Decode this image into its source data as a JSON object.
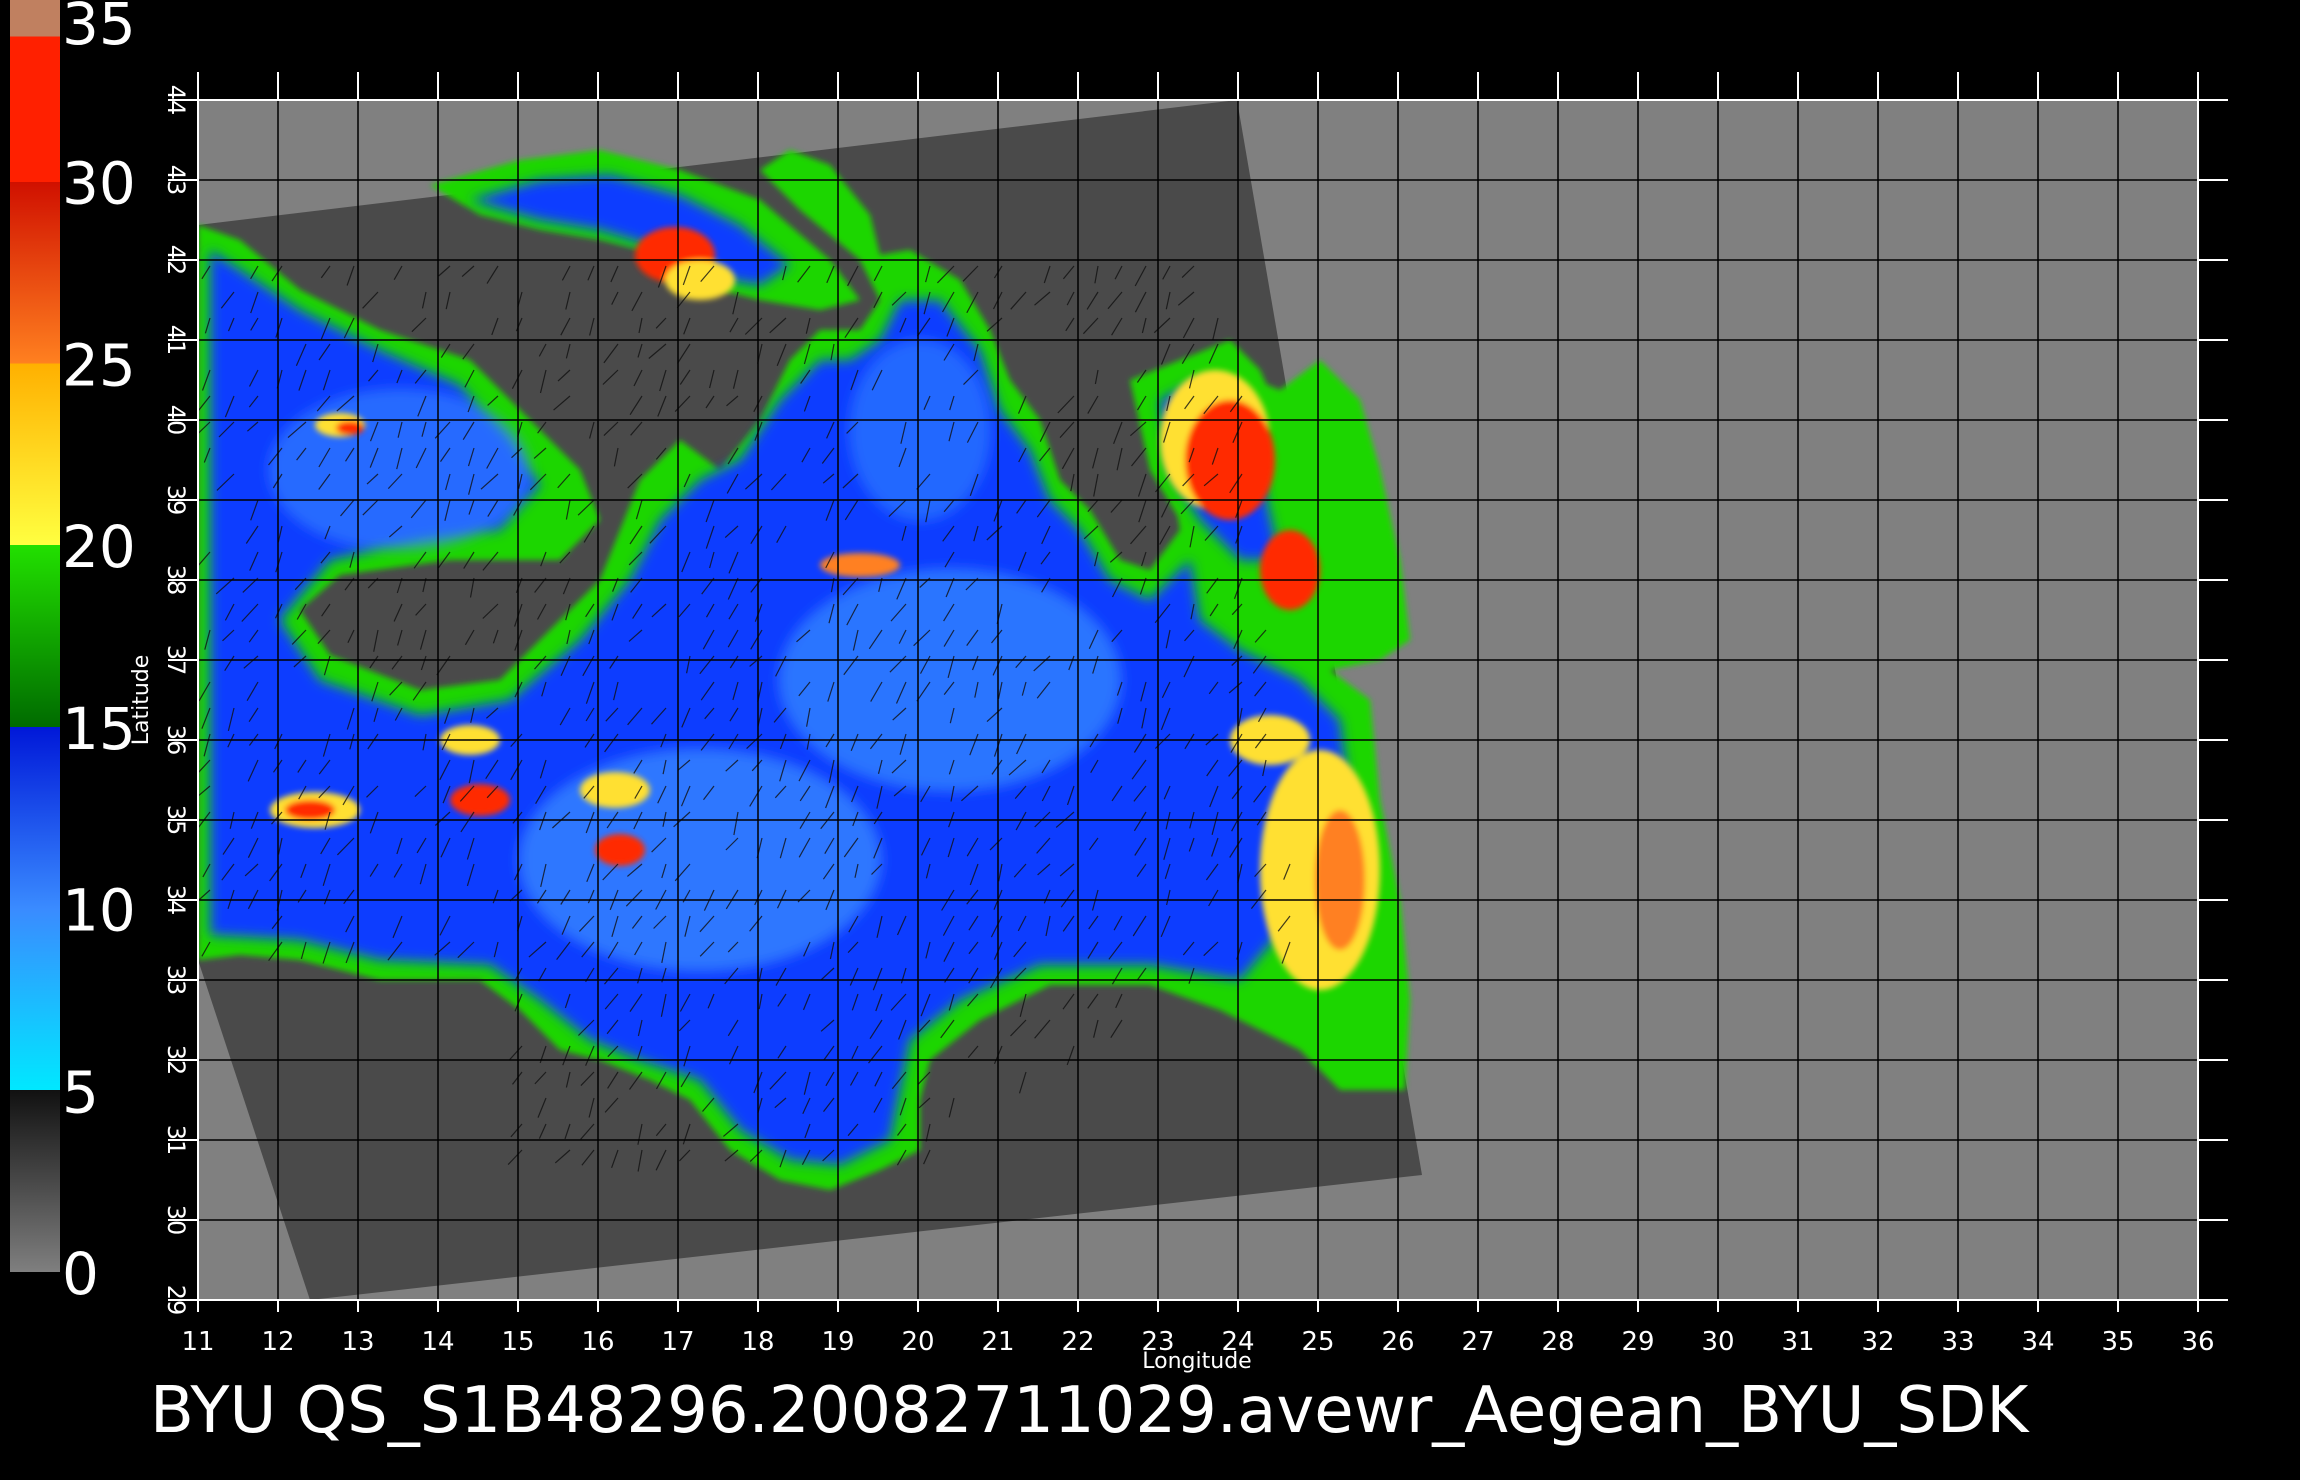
{
  "title": "BYU  QS_S1B48296.20082711029.avewr_Aegean_BYU_SDK",
  "colorbar": {
    "labels": [
      "35",
      "30",
      "25",
      "20",
      "15",
      "10",
      "5",
      "0"
    ],
    "min": 0,
    "max": 35,
    "stops": [
      {
        "value": 0,
        "color": "#7f7f7f"
      },
      {
        "value": 5,
        "color": "#111111"
      },
      {
        "value": 5,
        "color": "#00e8ff"
      },
      {
        "value": 10,
        "color": "#3a8bff"
      },
      {
        "value": 15,
        "color": "#0018d8"
      },
      {
        "value": 15,
        "color": "#006b00"
      },
      {
        "value": 20,
        "color": "#22e000"
      },
      {
        "value": 20,
        "color": "#ffff40"
      },
      {
        "value": 25,
        "color": "#ffb000"
      },
      {
        "value": 25,
        "color": "#ff8020"
      },
      {
        "value": 30,
        "color": "#d01000"
      },
      {
        "value": 30,
        "color": "#ff2000"
      },
      {
        "value": 34,
        "color": "#ff2000"
      },
      {
        "value": 34,
        "color": "#c08060"
      },
      {
        "value": 35,
        "color": "#c08060"
      }
    ]
  },
  "map": {
    "xlabel": "Longitude",
    "ylabel": "Latitude",
    "lon_ticks": [
      "11",
      "12",
      "13",
      "14",
      "15",
      "16",
      "17",
      "18",
      "19",
      "20",
      "21",
      "22",
      "23",
      "24",
      "25",
      "26",
      "27",
      "28",
      "29",
      "30",
      "31",
      "32",
      "33",
      "34",
      "35",
      "36"
    ],
    "lat_ticks": [
      "29",
      "30",
      "31",
      "32",
      "33",
      "34",
      "35",
      "36",
      "37",
      "38",
      "39",
      "40",
      "41",
      "42",
      "43",
      "44"
    ],
    "lon_range": [
      11,
      36
    ],
    "lat_range": [
      29,
      44
    ],
    "colors": {
      "background": "#000000",
      "no_data": "#808080",
      "swath": "#4a4a4a",
      "grid": "#000000",
      "ocean_low": "#0a3cff",
      "ocean_mid": "#3a8bff",
      "coast_green": "#1fd600",
      "coast_yellow": "#ffe030",
      "coast_red": "#ff2a00",
      "vectors": "#111111"
    }
  }
}
